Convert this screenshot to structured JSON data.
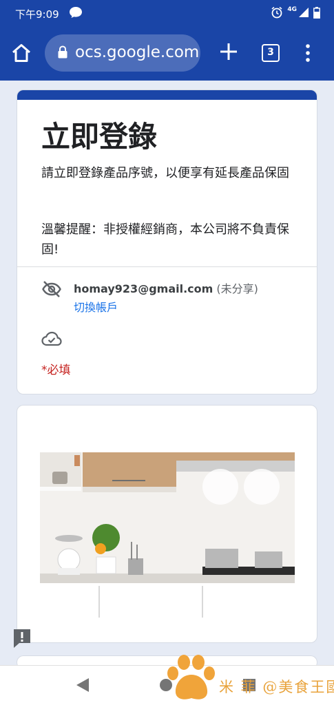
{
  "status_bar": {
    "time": "下午9:09",
    "network": "4G",
    "icons": [
      "message-bubble-icon",
      "alarm-icon",
      "signal-icon",
      "battery-icon"
    ]
  },
  "browser": {
    "url": "ocs.google.com",
    "tab_count": "3",
    "toolbar_color": "#1a45a7"
  },
  "form": {
    "title": "立即登錄",
    "description": "請立即登錄產品序號，以便享有延長產品保固",
    "notice": "溫馨提醒：非授權經銷商，本公司將不負責保固!",
    "account_email": "homay923@gmail.com",
    "not_shared": "(未分享)",
    "switch_account": "切換帳戶",
    "required_note": "*必填"
  },
  "image_card": {
    "image_alt": "kitchen-photo"
  },
  "watermark": {
    "text": "米   菲   @美食王國"
  },
  "colors": {
    "accent": "#1a45a7",
    "link": "#1a73e8",
    "required": "#c5221f",
    "watermark": "#e8a23a"
  }
}
